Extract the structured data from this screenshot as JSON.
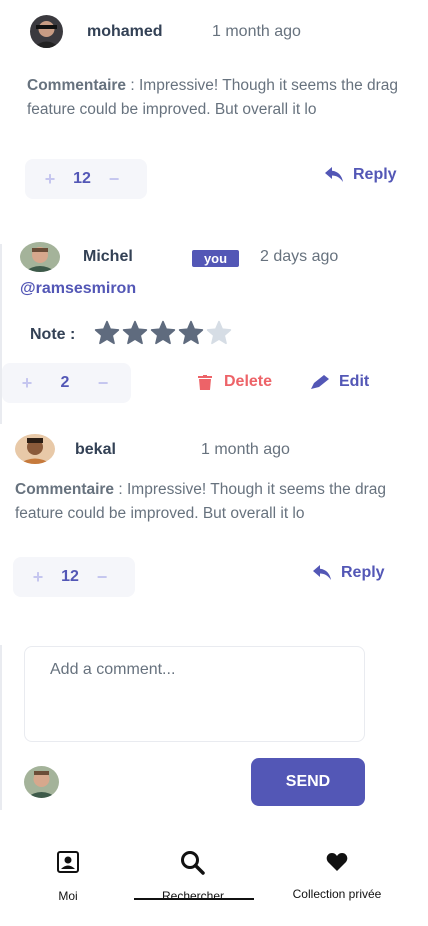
{
  "comments": [
    {
      "username": "mohamed",
      "time": "1 month ago",
      "comment_label": "Commentaire",
      "comment_sep": " : ",
      "text": "Impressive! Though it seems the drag feature could be improved. But overall it lo",
      "score": "12",
      "reply_label": "Reply"
    },
    {
      "username": "Michel",
      "badge": "you",
      "time": "2 days ago",
      "mention": "@ramsesmiron",
      "note_label": "Note :",
      "rating": 4,
      "rating_max": 5,
      "score": "2",
      "delete_label": "Delete",
      "edit_label": "Edit"
    },
    {
      "username": "bekal",
      "time": "1 month ago",
      "comment_label": "Commentaire",
      "comment_sep": " : ",
      "text": "Impressive! Though it seems the drag feature could be improved. But overall it lo",
      "score": "12",
      "reply_label": "Reply"
    }
  ],
  "composer": {
    "placeholder": "Add a comment...",
    "send_label": "SEND"
  },
  "vote": {
    "plus": "+",
    "minus": "−"
  },
  "bottom_nav": {
    "items": [
      {
        "label": "Moi",
        "icon": "user-icon"
      },
      {
        "label": "Rechercher",
        "icon": "search-icon",
        "active": true
      },
      {
        "label": "Collection privée",
        "icon": "heart-icon"
      }
    ]
  },
  "colors": {
    "accent": "#5357b6",
    "danger": "#ed6368",
    "star_filled": "#5f6b7e",
    "star_empty": "#d6dde5"
  }
}
